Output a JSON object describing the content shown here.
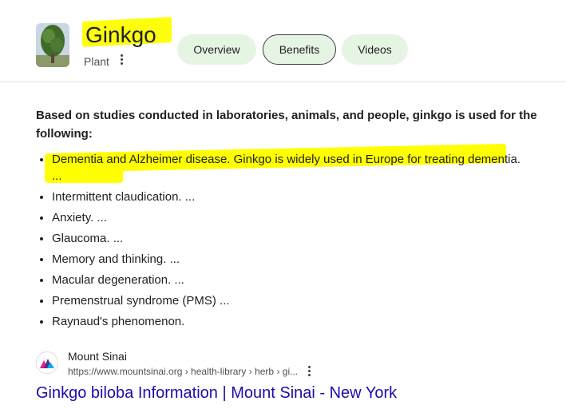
{
  "header": {
    "title": "Ginkgo",
    "subtitle": "Plant",
    "thumbnail_icon": "ginkgo-tree-image",
    "highlight_color": "#ffff00"
  },
  "tabs": [
    {
      "label": "Overview",
      "selected": false
    },
    {
      "label": "Benefits",
      "selected": true
    },
    {
      "label": "Videos",
      "selected": false
    }
  ],
  "content": {
    "lead": "Based on studies conducted in laboratories, animals, and people, ginkgo is used for the following:",
    "items": [
      "Dementia and Alzheimer disease. Ginkgo is widely used in Europe for treating dementia. ...",
      "Intermittent claudication. ...",
      "Anxiety. ...",
      "Glaucoma. ...",
      "Memory and thinking. ...",
      "Macular degeneration. ...",
      "Premenstrual syndrome (PMS) ...",
      "Raynaud's phenomenon."
    ]
  },
  "source": {
    "site_name": "Mount Sinai",
    "url": "https://www.mountsinai.org › health-library › herb › gi...",
    "link_text": "Ginkgo biloba Information | Mount Sinai - New York",
    "favicon_icon": "mount-sinai-logo"
  }
}
